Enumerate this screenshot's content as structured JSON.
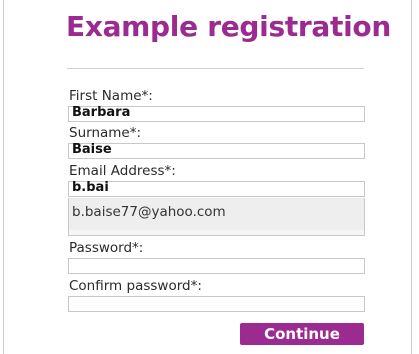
{
  "form": {
    "title": "Example registration",
    "first_name": {
      "label": "First Name*:",
      "value": "Barbara"
    },
    "surname": {
      "label": "Surname*:",
      "value": "Baise"
    },
    "email": {
      "label": "Email Address*:",
      "value": "b.bai",
      "suggestion": "b.baise77@yahoo.com"
    },
    "password": {
      "label": "Password*:",
      "value": ""
    },
    "confirm_password": {
      "label": "Confirm password*:",
      "value": ""
    },
    "continue_label": "Continue"
  },
  "colors": {
    "accent": "#9b2b90",
    "field_border": "#c8c8c8",
    "suggestion_bg": "#eeeeee"
  }
}
